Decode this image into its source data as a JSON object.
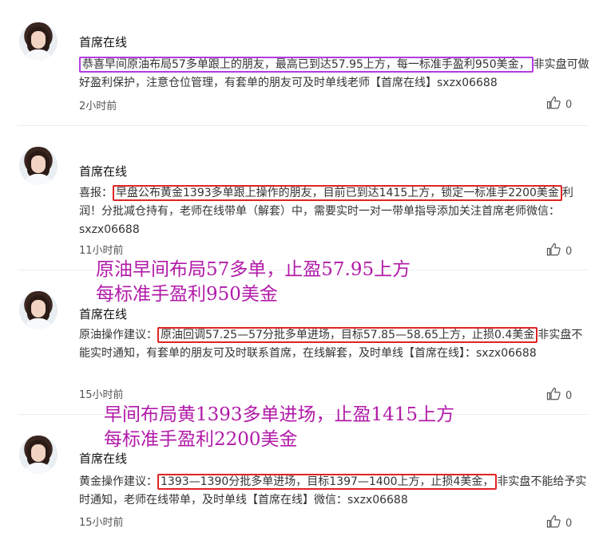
{
  "posts": [
    {
      "author": "首席在线",
      "before": "",
      "highlight": "恭喜早间原油布局57多单跟上的朋友，最高已到达57.95上方，每一标准手盈利950美金，",
      "after": "非实盘可做好盈利保护，注意仓位管理，有套单的朋友可及时单线老师【首席在线】sxzx06688",
      "time": "2小时前",
      "likes": "0",
      "highlight_color": "#b23be0"
    },
    {
      "author": "首席在线",
      "before": "喜报：",
      "highlight": "早盘公布黄金1393多单跟上操作的朋友，目前已到达1415上方，锁定一标准手2200美金",
      "after": "利润！分批减仓持有，老师在线带单（解套）中，需要实时一对一带单指导添加关注首席老师微信：sxzx06688",
      "time": "11小时前",
      "likes": "0",
      "highlight_color": "#e02323"
    },
    {
      "author": "首席在线",
      "before": "原油操作建议：",
      "highlight": "原油回调57.25—57分批多单进场，目标57.85—58.65上方，止损0.4美金",
      "after": "非实盘不能实时通知，有套单的朋友可及时联系首席，在线解套，及时单线【首席在线】：sxzx06688",
      "time": "15小时前",
      "likes": "0",
      "highlight_color": "#e02323"
    },
    {
      "author": "首席在线",
      "before": "黄金操作建议：",
      "highlight": "1393—1390分批多单进场，目标1397—1400上方，止损4美金，",
      "after": "非实盘不能给予实时通知，老师在线带单，及时单线【首席在线】微信：sxzx06688",
      "time": "15小时前",
      "likes": "0",
      "highlight_color": "#e02323"
    }
  ],
  "overlays": [
    {
      "line1": "原油早间布局57多单，止盈57.95上方",
      "line2": "每标准手盈利950美金"
    },
    {
      "line1": "早间布局黄1393多单进场，止盈1415上方",
      "line2": "每标准手盈利2200美金"
    }
  ],
  "colors": {
    "overlay": "#b21aa9",
    "purple_box": "#b23be0",
    "red_box": "#e02323"
  },
  "icons": {
    "like": "thumbs-up-icon",
    "avatar": "user-avatar"
  }
}
